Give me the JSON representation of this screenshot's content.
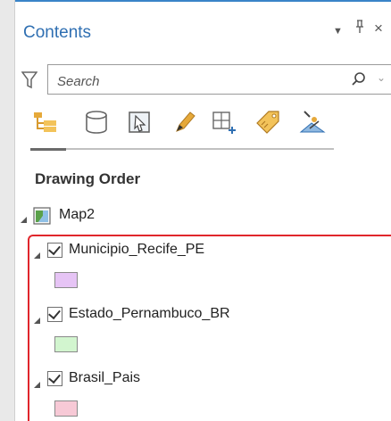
{
  "panel": {
    "title": "Contents",
    "controls": {
      "menu": "▼",
      "pin": "ᚬ",
      "close": "×"
    }
  },
  "search": {
    "placeholder": "Search"
  },
  "toolbar": {
    "icons": [
      "list-by-drawing-order-icon",
      "list-by-data-source-icon",
      "list-by-selection-icon",
      "list-by-editing-icon",
      "list-by-snapping-icon",
      "list-by-labeling-icon",
      "list-by-perspective-icon"
    ]
  },
  "section": {
    "header": "Drawing Order"
  },
  "map": {
    "name": "Map2",
    "icon": "map-icon"
  },
  "layers": [
    {
      "name": "Municipio_Recife_PE",
      "checked": true,
      "swatch_color": "#e6c4f5"
    },
    {
      "name": "Estado_Pernambuco_BR",
      "checked": true,
      "swatch_color": "#d2f5cf"
    },
    {
      "name": "Brasil_Pais",
      "checked": true,
      "swatch_color": "#f7c9d6"
    }
  ],
  "colors": {
    "accent": "#2f6fb2",
    "highlight_border": "#e0262c"
  }
}
